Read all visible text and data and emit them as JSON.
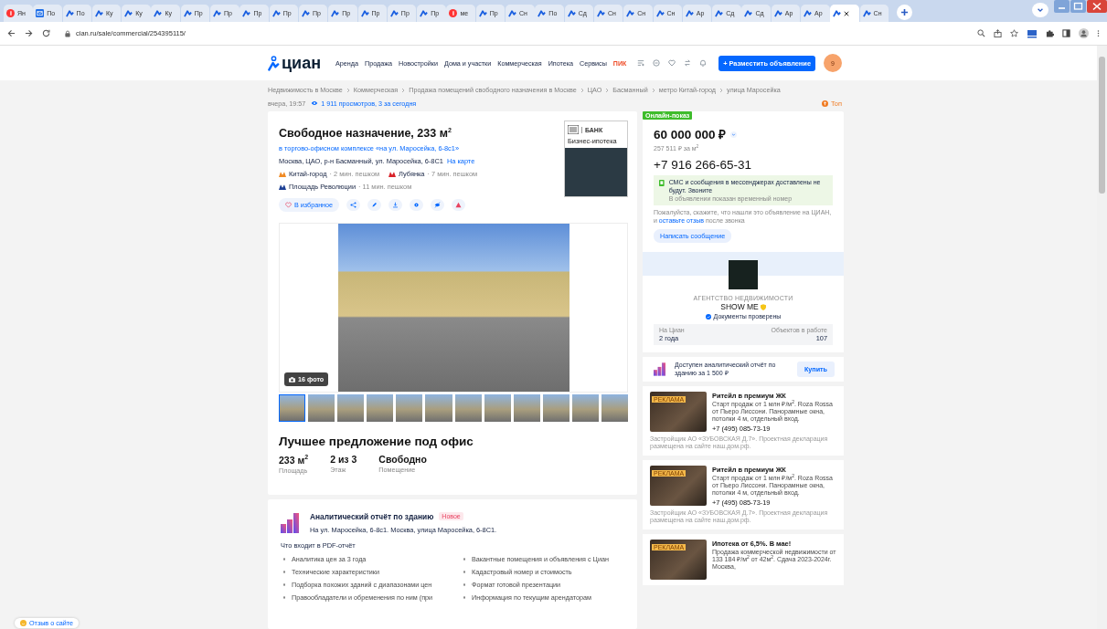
{
  "browser": {
    "tabs": [
      {
        "label": "Ян",
        "kind": "yandex",
        "selected": false
      },
      {
        "label": "По",
        "kind": "mail",
        "selected": false
      },
      {
        "label": "По",
        "kind": "cian",
        "selected": false
      },
      {
        "label": "Ку",
        "kind": "cian",
        "selected": false
      },
      {
        "label": "Ку",
        "kind": "cian",
        "selected": false
      },
      {
        "label": "Ку",
        "kind": "cian",
        "selected": false
      },
      {
        "label": "Пр",
        "kind": "cian",
        "selected": false
      },
      {
        "label": "Пр",
        "kind": "cian",
        "selected": false
      },
      {
        "label": "Пр",
        "kind": "cian",
        "selected": false
      },
      {
        "label": "Пр",
        "kind": "cian",
        "selected": false
      },
      {
        "label": "Пр",
        "kind": "cian",
        "selected": false
      },
      {
        "label": "Пр",
        "kind": "cian",
        "selected": false
      },
      {
        "label": "Пр",
        "kind": "cian",
        "selected": false
      },
      {
        "label": "Пр",
        "kind": "cian",
        "selected": false
      },
      {
        "label": "Пр",
        "kind": "cian",
        "selected": false
      },
      {
        "label": "ме",
        "kind": "yandex",
        "selected": false
      },
      {
        "label": "Пр",
        "kind": "cian",
        "selected": false
      },
      {
        "label": "Сн",
        "kind": "cian",
        "selected": false
      },
      {
        "label": "По",
        "kind": "cian",
        "selected": false
      },
      {
        "label": "Сд",
        "kind": "cian",
        "selected": false
      },
      {
        "label": "Сн",
        "kind": "cian",
        "selected": false
      },
      {
        "label": "Сн",
        "kind": "cian",
        "selected": false
      },
      {
        "label": "Сн",
        "kind": "cian",
        "selected": false
      },
      {
        "label": "Ар",
        "kind": "cian",
        "selected": false
      },
      {
        "label": "Сд",
        "kind": "cian",
        "selected": false
      },
      {
        "label": "Сд",
        "kind": "cian",
        "selected": false
      },
      {
        "label": "Ар",
        "kind": "cian",
        "selected": false
      },
      {
        "label": "Ар",
        "kind": "cian",
        "selected": false
      },
      {
        "kind": "cian",
        "selected": true
      },
      {
        "label": "Сн",
        "kind": "cian",
        "selected": false
      }
    ],
    "url": "cian.ru/sale/commercial/254395115/"
  },
  "header": {
    "logo": "циан",
    "nav": [
      "Аренда",
      "Продажа",
      "Новостройки",
      "Дома и участки",
      "Коммерческая",
      "Ипотека",
      "Сервисы"
    ],
    "promo": "ПИК",
    "post_button": "+ Разместить объявление",
    "avatar": "9"
  },
  "breadcrumbs": [
    "Недвижимость в Москве",
    "Коммерческая",
    "Продажа помещений свободного назначения в Москве",
    "ЦАО",
    "Басманный",
    "метро Китай-город",
    "улица Маросейка"
  ],
  "meta": {
    "date": "вчера, 19:57",
    "views": "1 911 просмотров, 3 за сегодня",
    "top": "Топ"
  },
  "listing": {
    "title": "Свободное назначение, 233 м$^{2}$",
    "complex": "в торгово-офисном комплексе «на ул. Маросейка, 6-8с1»",
    "address": "Москва, ЦАО, р-н Басманный, ул. Маросейка, 6-8С1",
    "map_link": "На карте",
    "metro": [
      {
        "station": "Китай-город",
        "walk": "· 2 мин. пешком",
        "color": "#f08a24"
      },
      {
        "station": "Лубянка",
        "walk": "· 7 мин. пешком",
        "color": "#d8232a"
      },
      {
        "station": "Площадь Революции",
        "walk": "· 11 мин. пешком",
        "color": "#1c3f94"
      }
    ],
    "favorite": "В избранное",
    "bank_ad": {
      "label": "БАНК",
      "title": "Бизнес-ипотека"
    },
    "photo_count": "16 фото",
    "thumbnails": [
      {
        "selected": true
      },
      {
        "selected": false
      },
      {
        "selected": false
      },
      {
        "selected": false
      },
      {
        "selected": false
      },
      {
        "selected": false
      },
      {
        "selected": false
      },
      {
        "selected": false
      },
      {
        "selected": false
      },
      {
        "selected": false
      },
      {
        "selected": false
      },
      {
        "selected": false
      }
    ],
    "headline": "Лучшее предложение под офис",
    "facts": [
      {
        "value": "233 м$^{2}$",
        "label": "Площадь"
      },
      {
        "value": "2 из 3",
        "label": "Этаж"
      },
      {
        "value": "Свободно",
        "label": "Помещение"
      }
    ]
  },
  "report": {
    "title": "Аналитический отчёт по зданию",
    "badge": "Новое",
    "address": "На ул. Маросейка, 6-8с1. Москва, улица Маросейка, 6-8С1.",
    "includes_title": "Что входит в PDF-отчёт",
    "items": [
      "Аналитика цен за 3 года",
      "Вакантные помещения и объявления с Циан",
      "Технические характеристики",
      "Кадастровый номер и стоимость",
      "Подборка похожих зданий с диапазонами цен",
      "Формат готовой презентации",
      "Правообладатели и обременения по ним (при",
      "Информация по текущим арендаторам"
    ]
  },
  "sidebar": {
    "badge": "Онлайн-показ",
    "price": "60 000 000 ₽",
    "price_per_m": "257 511 ₽ за м$^{2}$",
    "phone": "+7 916 266-65-31",
    "notice": "СМС и сообщения в мессенджерах доставлены не будут. Звоните",
    "notice_sub": "В объявлении показан временный номер",
    "feedback_before": "Пожалуйста, скажите, что нашли это объявление на ЦИАН, и ",
    "feedback_link": "оставьте отзыв",
    "feedback_after": " после звонка",
    "message_button": "Написать сообщение",
    "agency": {
      "type": "АГЕНТСТВО НЕДВИЖИМОСТИ",
      "name": "SHOW ME",
      "verified": "Документы проверены",
      "stats": [
        {
          "label": "На Циан",
          "value": "2 года"
        },
        {
          "label": "Объектов в работе",
          "value": "107"
        }
      ]
    }
  },
  "report_offer": {
    "text": "Доступен аналитический отчёт по зданию за 1 500 ₽",
    "button": "Купить"
  },
  "ads": [
    {
      "badge": "РЕКЛАМА",
      "title": "Ритейл в премиум ЖК",
      "text": "Старт продаж от 1 млн ₽/м$^{2}$. Roza Rossa от Пьеро Лиссони. Панорамные окна, потолки 4 м, отдельный вход.",
      "phone": "+7 (495) 085-73-19",
      "disclaimer": "Застройщик АО «ЗУБОВСКАЯ Д.7». Проектная декларация размещена на сайте наш.дом.рф."
    },
    {
      "badge": "РЕКЛАМА",
      "title": "Ритейл в премиум ЖК",
      "text": "Старт продаж от 1 млн ₽/м$^{2}$. Roza Rossa от Пьеро Лиссони. Панорамные окна, потолки 4 м, отдельный вход.",
      "phone": "+7 (495) 085-73-19",
      "disclaimer": "Застройщик АО «ЗУБОВСКАЯ Д.7». Проектная декларация размещена на сайте наш.дом.рф."
    },
    {
      "badge": "РЕКЛАМА",
      "title": "Ипотека от 6,5%. В мае!",
      "text": "Продажа коммерческой недвижимости от 133 184 ₽/м$^{2}$ от 42м$^{2}$. Сдача 2023-2024г. Москва,"
    }
  ],
  "feedback_button": "Отзыв о сайте"
}
